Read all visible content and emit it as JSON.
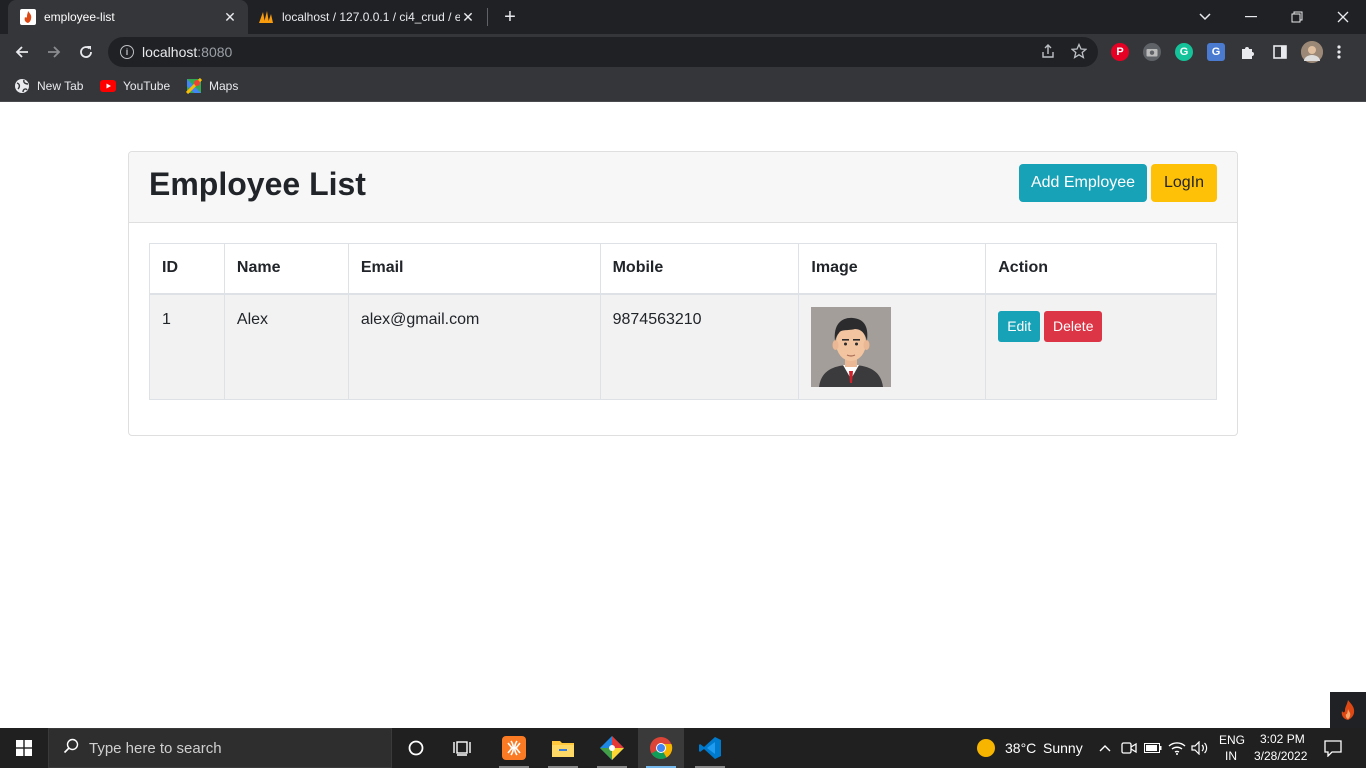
{
  "browser": {
    "tabs": [
      {
        "title": "employee-list",
        "favicon": "codeigniter-flame-icon",
        "active": true
      },
      {
        "title": "localhost / 127.0.0.1 / ci4_crud / e",
        "favicon": "phpmyadmin-icon",
        "active": false
      }
    ],
    "address": {
      "host": "localhost",
      "port": ":8080"
    },
    "bookmarks": [
      {
        "label": "New Tab",
        "icon": "globe-icon"
      },
      {
        "label": "YouTube",
        "icon": "youtube-icon"
      },
      {
        "label": "Maps",
        "icon": "maps-icon"
      }
    ]
  },
  "page": {
    "title": "Employee List",
    "add_button": "Add Employee",
    "login_button": "LogIn",
    "table": {
      "headers": [
        "ID",
        "Name",
        "Email",
        "Mobile",
        "Image",
        "Action"
      ],
      "rows": [
        {
          "id": "1",
          "name": "Alex",
          "email": "alex@gmail.com",
          "mobile": "9874563210",
          "image": "employee-avatar",
          "edit": "Edit",
          "delete": "Delete"
        }
      ]
    }
  },
  "taskbar": {
    "search_placeholder": "Type here to search",
    "weather": {
      "temp": "38°C",
      "condition": "Sunny"
    },
    "language": {
      "line1": "ENG",
      "line2": "IN"
    },
    "time": "3:02 PM",
    "date": "3/28/2022"
  },
  "colors": {
    "info": "#17a2b8",
    "warning": "#ffc107",
    "danger": "#dc3545"
  }
}
